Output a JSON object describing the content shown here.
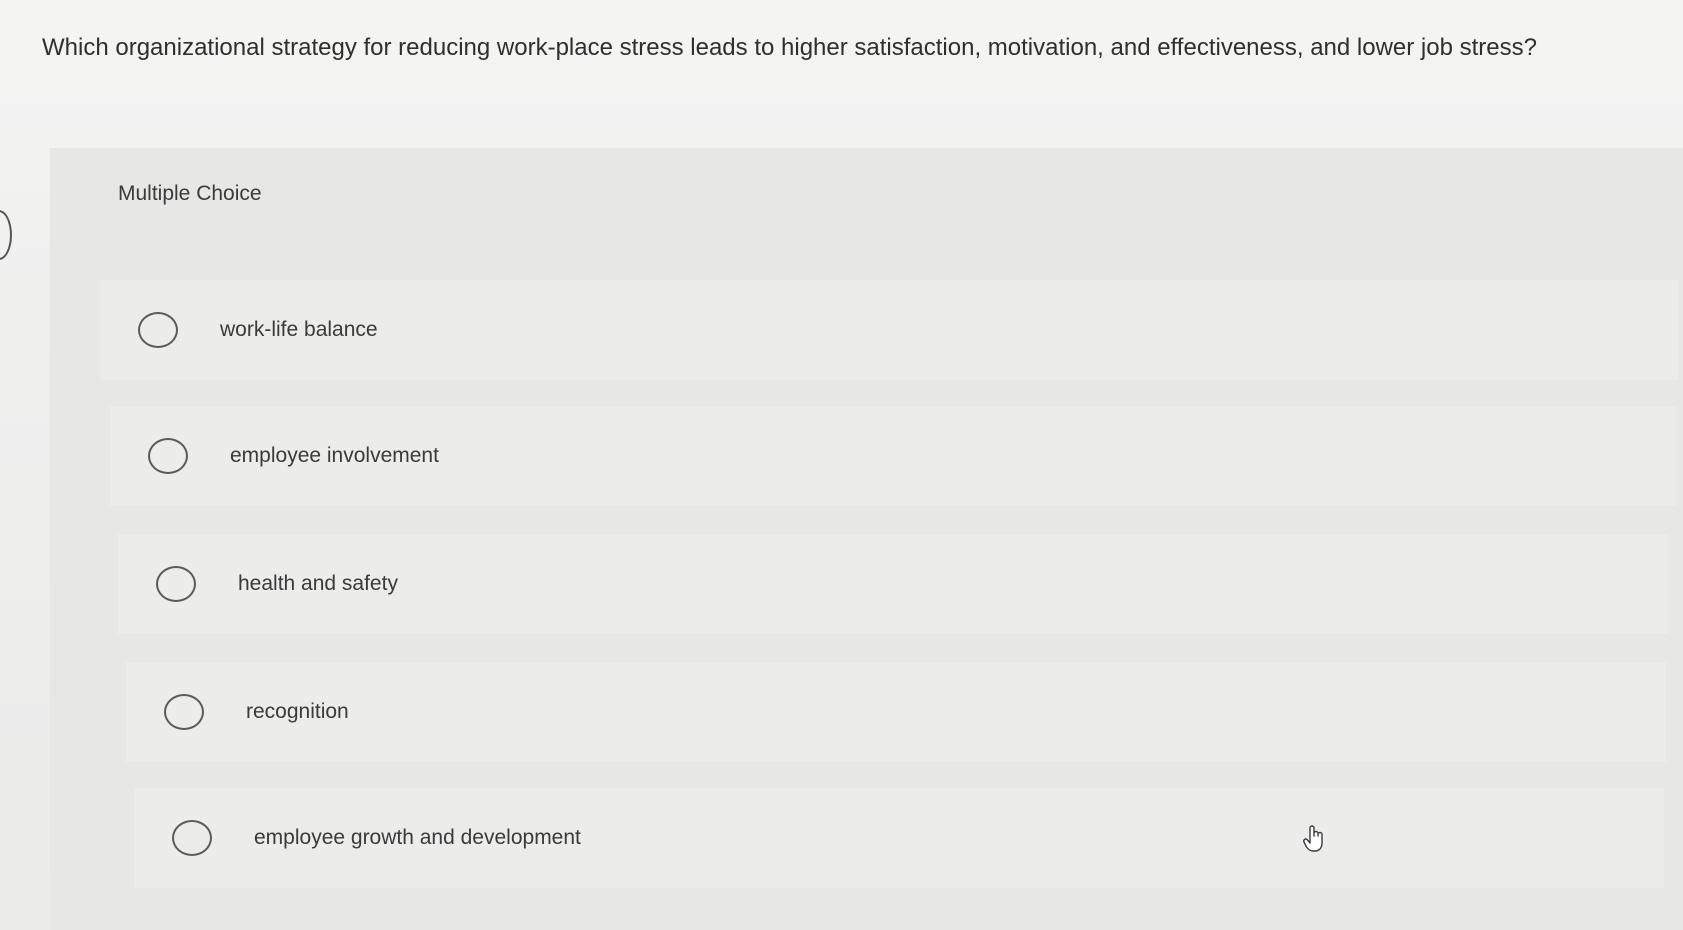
{
  "question": {
    "text": "Which organizational strategy for reducing work-place stress leads to higher satisfaction, motivation, and effectiveness, and lower job stress?"
  },
  "panel": {
    "label": "Multiple Choice"
  },
  "options": [
    {
      "label": "work-life balance",
      "selected": false
    },
    {
      "label": "employee involvement",
      "selected": false
    },
    {
      "label": "health and safety",
      "selected": false
    },
    {
      "label": "recognition",
      "selected": false
    },
    {
      "label": "employee growth and development",
      "selected": false
    }
  ],
  "icons": {
    "cursor": "hand-pointer-icon",
    "radio": "radio-circle-icon"
  },
  "colors": {
    "background": "#f2f2f1",
    "panel": "#e7e7e6",
    "option_row": "#ececeb",
    "text": "#3a3a3a"
  }
}
